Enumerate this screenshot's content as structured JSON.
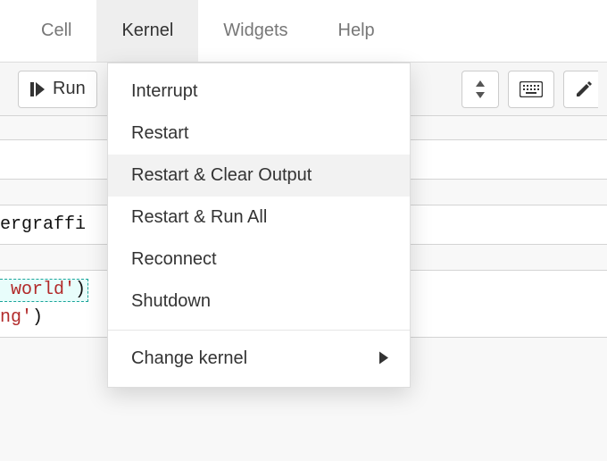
{
  "menubar": {
    "cell": "Cell",
    "kernel": "Kernel",
    "widgets": "Widgets",
    "help": "Help"
  },
  "toolbar": {
    "run_label": "Run"
  },
  "kernel_menu": {
    "interrupt": "Interrupt",
    "restart": "Restart",
    "restart_clear": "Restart & Clear Output",
    "restart_run": "Restart & Run All",
    "reconnect": "Reconnect",
    "shutdown": "Shutdown",
    "change_kernel": "Change kernel"
  },
  "code": {
    "frag1": "ergraffi",
    "line1_a": " world'",
    "line1_b": ")",
    "line2_a": "ng'",
    "line2_b": ")"
  }
}
